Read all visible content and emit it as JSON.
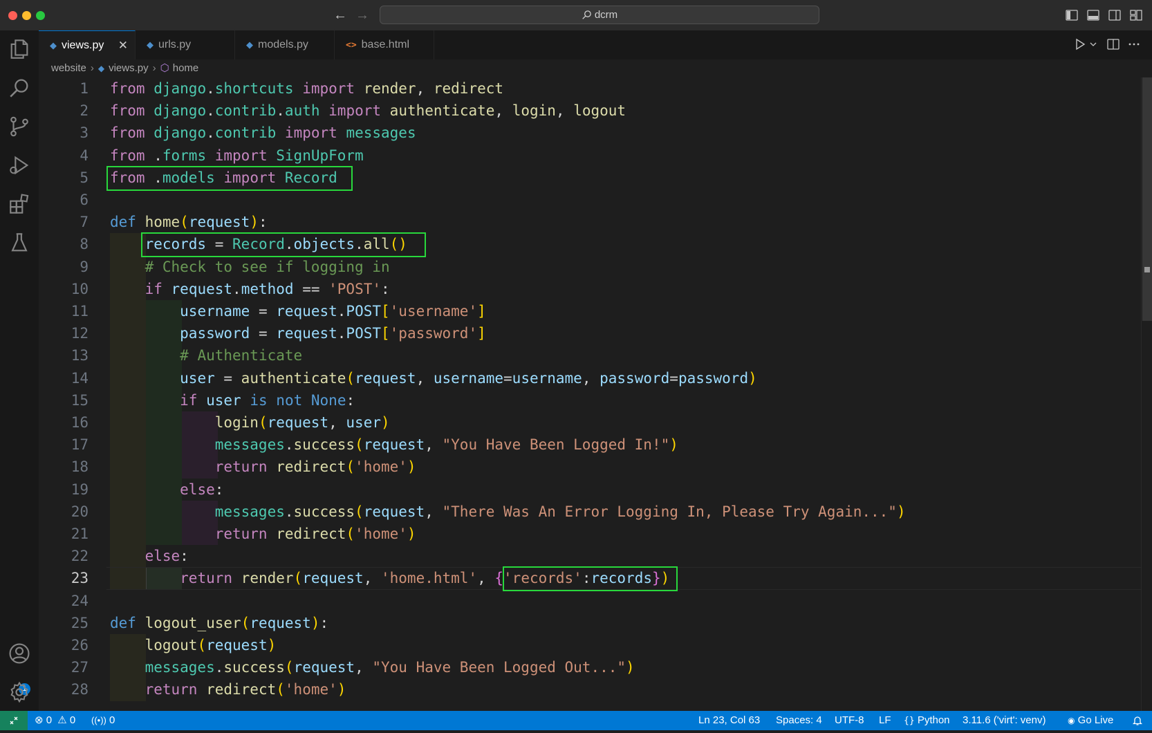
{
  "window": {
    "search_text": "dcrm"
  },
  "tabs": [
    {
      "label": "views.py",
      "active": true,
      "icon": "python-file-icon"
    },
    {
      "label": "urls.py",
      "active": false,
      "icon": "python-file-icon"
    },
    {
      "label": "models.py",
      "active": false,
      "icon": "python-file-icon"
    },
    {
      "label": "base.html",
      "active": false,
      "icon": "html-file-icon"
    }
  ],
  "tab_close_glyph": "✕",
  "breadcrumb": {
    "folder": "website",
    "file": "views.py",
    "symbol": "home"
  },
  "editor": {
    "current_line": 23,
    "line_numbers": [
      "1",
      "2",
      "3",
      "4",
      "5",
      "6",
      "7",
      "8",
      "9",
      "10",
      "11",
      "12",
      "13",
      "14",
      "15",
      "16",
      "17",
      "18",
      "19",
      "20",
      "21",
      "22",
      "23",
      "24",
      "25",
      "26",
      "27",
      "28"
    ]
  },
  "activity_bar": {
    "icons": [
      "explorer-icon",
      "search-icon",
      "source-control-icon",
      "run-debug-icon",
      "extensions-icon",
      "testing-icon",
      "accounts-icon",
      "manage-gear-icon"
    ],
    "accounts_badge": "1"
  },
  "statusbar": {
    "errors": "0",
    "warnings": "0",
    "ports": "0",
    "cursor": "Ln 23, Col 63",
    "spaces": "Spaces: 4",
    "encoding": "UTF-8",
    "eol": "LF",
    "language": "Python",
    "interpreter": "3.11.6 ('virt': venv)",
    "go_live": "Go Live"
  },
  "colors": {
    "statusbar": "#0078d4",
    "highlight_box": "#28d83c",
    "keyword": "#c586c0",
    "string": "#ce9178",
    "comment": "#6a9955",
    "function": "#dcdcaa",
    "class": "#4ec9b0",
    "variable": "#9cdcfe"
  }
}
